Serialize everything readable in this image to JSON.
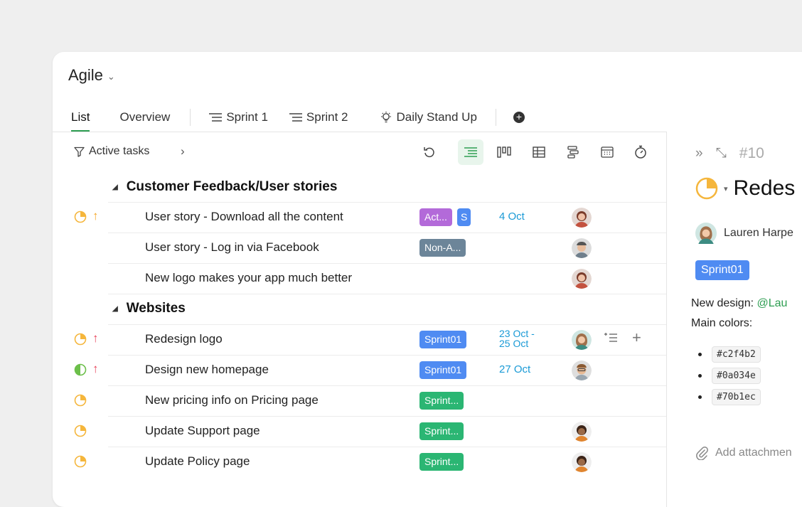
{
  "title": "Agile",
  "tabs": [
    {
      "label": "List",
      "active": true
    },
    {
      "label": "Overview"
    },
    {
      "label": "Sprint 1"
    },
    {
      "label": "Sprint 2"
    },
    {
      "label": "Daily Stand Up"
    }
  ],
  "toolbar": {
    "filter_label": "Active tasks"
  },
  "groups": [
    {
      "title": "Customer Feedback/User stories",
      "tasks": [
        {
          "name": "User story - Download all the content",
          "tags": [
            "Act...",
            "S"
          ],
          "date": "4 Oct"
        },
        {
          "name": "User story - Log in via Facebook",
          "tags": [
            "Non-A..."
          ],
          "date": ""
        },
        {
          "name": "New logo makes your app much better",
          "tags": [],
          "date": ""
        }
      ]
    },
    {
      "title": "Websites",
      "tasks": [
        {
          "name": "Redesign logo",
          "tags": [
            "Sprint01"
          ],
          "date": "23 Oct -\n25 Oct"
        },
        {
          "name": "Design new homepage",
          "tags": [
            "Sprint01"
          ],
          "date": "27 Oct"
        },
        {
          "name": "New pricing info on Pricing page",
          "tags": [
            "Sprint..."
          ],
          "date": ""
        },
        {
          "name": "Update Support page",
          "tags": [
            "Sprint..."
          ],
          "date": ""
        },
        {
          "name": "Update Policy page",
          "tags": [
            "Sprint..."
          ],
          "date": ""
        }
      ]
    }
  ],
  "panel": {
    "task_number": "#10",
    "title": "Redes",
    "owner": "Lauren Harpe",
    "sprint": "Sprint01",
    "text_prefix": "New design: ",
    "mention": "@Lau",
    "colors_label": "Main colors:",
    "colors": [
      "#c2f4b2",
      "#0a034e",
      "#70b1ec"
    ],
    "attach_label": "Add attachmen"
  },
  "palette": {
    "accent": "#2e9e52",
    "purple_tag": "#b36ad9",
    "blue_tag": "#4f8bf2",
    "grey_tag": "#6c8599",
    "green_tag": "#2bb673",
    "date_blue": "#1a9ad6",
    "status_yellow": "#f5b63c",
    "prio_orange": "#f5a623",
    "prio_red": "#e8445a"
  }
}
